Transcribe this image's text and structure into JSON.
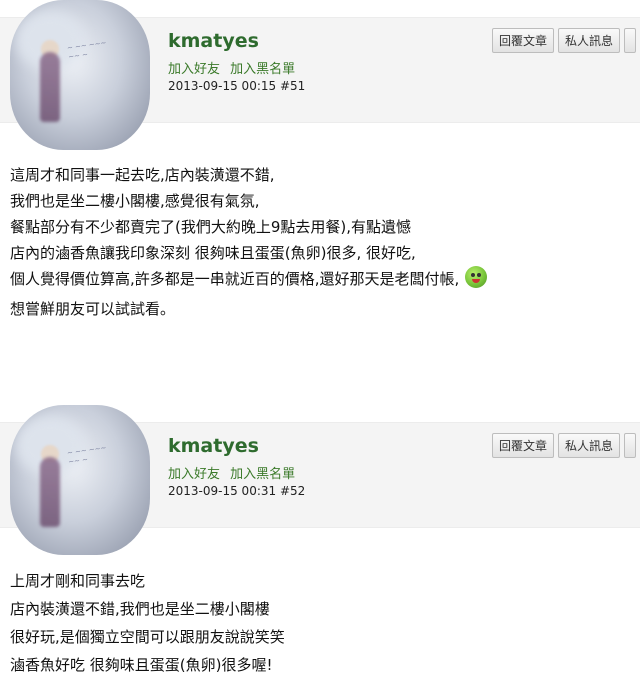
{
  "posts": [
    {
      "username": "kmatyes",
      "add_friend": "加入好友",
      "add_blacklist": "加入黑名單",
      "timestamp": "2013-09-15 00:15",
      "post_no": "#51",
      "reply_button": "回覆文章",
      "pm_button": "私人訊息",
      "body_lines": [
        "這周才和同事一起去吃,店內裝潢還不錯,",
        "我們也是坐二樓小閣樓,感覺很有氣氛,",
        "餐點部分有不少都賣完了(我們大約晚上9點去用餐),有點遺憾",
        "店內的滷香魚讓我印象深刻 很夠味且蛋蛋(魚卵)很多, 很好吃,",
        "個人覺得價位算高,許多都是一串就近百的價格,還好那天是老闆付帳,",
        "想嘗鮮朋友可以試試看。"
      ],
      "emoji_icon": "smiley-face-icon"
    },
    {
      "username": "kmatyes",
      "add_friend": "加入好友",
      "add_blacklist": "加入黑名單",
      "timestamp": "2013-09-15 00:31",
      "post_no": "#52",
      "reply_button": "回覆文章",
      "pm_button": "私人訊息",
      "body_lines": [
        "上周才剛和同事去吃",
        "店內裝潢還不錯,我們也是坐二樓小閣樓",
        "很好玩,是個獨立空間可以跟朋友說說笑笑",
        "滷香魚好吃 很夠味且蛋蛋(魚卵)很多喔!"
      ]
    }
  ],
  "colors": {
    "username": "#2e6b2e",
    "action_links": "#3b7a2a",
    "header_bg": "#f4f4f4"
  }
}
